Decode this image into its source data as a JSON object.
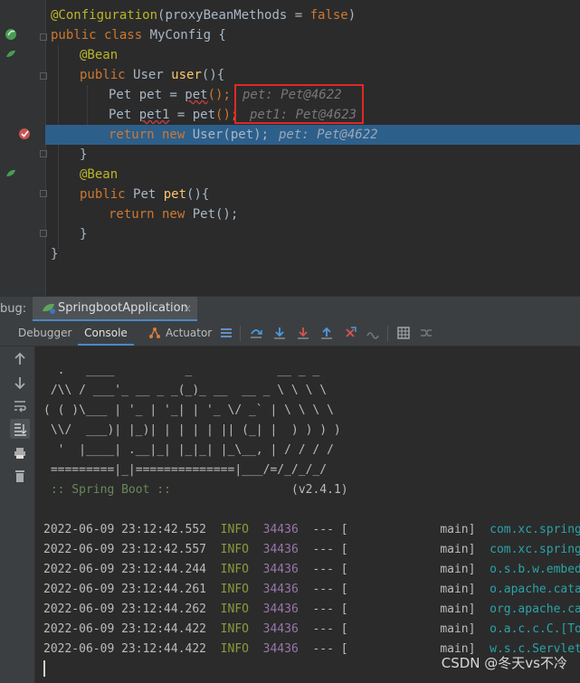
{
  "editor": {
    "lines": {
      "l1_annotation": "@Configuration",
      "l1_args": "(proxyBeanMethods = ",
      "l1_false": "false",
      "l1_close": ")",
      "l2_public": "public class ",
      "l2_name": "MyConfig {",
      "l3": "@Bean",
      "l4_public": "public ",
      "l4_type": "User ",
      "l4_method": "user",
      "l4_rest": "(){",
      "l5_code": "Pet pet = ",
      "l5_call": "pet",
      "l5_end": "();",
      "l5_hint": "pet: Pet@4622",
      "l6_code": "Pet ",
      "l6_var": "pet1",
      "l6_eq": " = ",
      "l6_call": "pet",
      "l6_end": "();",
      "l6_hint": "pet1: Pet@4623",
      "l7_return": "return new ",
      "l7_code": "User(pet);",
      "l7_hint": "pet: Pet@4622",
      "l8": "}",
      "l9": "@Bean",
      "l10_public": "public ",
      "l10_type": "Pet ",
      "l10_method": "pet",
      "l10_rest": "(){",
      "l11_return": "return new ",
      "l11_code": "Pet();",
      "l12": "}",
      "l13": "}"
    }
  },
  "debug": {
    "label": "bug:",
    "config_tab": "SpringbootApplication",
    "close": "×",
    "tabs": [
      "Debugger",
      "Console",
      "Actuator"
    ]
  },
  "console": {
    "banner": [
      "  .   ____          _            __ _ _",
      " /\\\\ / ___'_ __ _ _(_)_ __  __ _ \\ \\ \\ \\",
      "( ( )\\___ | '_ | '_| | '_ \\/ _` | \\ \\ \\ \\",
      " \\\\/  ___)| |_)| | | | | || (_| |  ) ) ) )",
      "  '  |____| .__|_| |_|_| |_\\__, | / / / /",
      " =========|_|==============|___/=/_/_/_/"
    ],
    "spring_boot": " :: Spring Boot ::",
    "version": "(v2.4.1)",
    "logs": [
      {
        "ts": "2022-06-09 23:12:42.552",
        "level": "INFO",
        "pid": "34436",
        "sep": "--- [",
        "thread": "           main]",
        "logger": "com.xc.springboo"
      },
      {
        "ts": "2022-06-09 23:12:42.557",
        "level": "INFO",
        "pid": "34436",
        "sep": "--- [",
        "thread": "           main]",
        "logger": "com.xc.springboo"
      },
      {
        "ts": "2022-06-09 23:12:44.244",
        "level": "INFO",
        "pid": "34436",
        "sep": "--- [",
        "thread": "           main]",
        "logger": "o.s.b.w.embedded"
      },
      {
        "ts": "2022-06-09 23:12:44.261",
        "level": "INFO",
        "pid": "34436",
        "sep": "--- [",
        "thread": "           main]",
        "logger": "o.apache.catalin"
      },
      {
        "ts": "2022-06-09 23:12:44.262",
        "level": "INFO",
        "pid": "34436",
        "sep": "--- [",
        "thread": "           main]",
        "logger": "org.apache.catal"
      },
      {
        "ts": "2022-06-09 23:12:44.422",
        "level": "INFO",
        "pid": "34436",
        "sep": "--- [",
        "thread": "           main]",
        "logger": "o.a.c.c.C.[Tomca"
      },
      {
        "ts": "2022-06-09 23:12:44.422",
        "level": "INFO",
        "pid": "34436",
        "sep": "--- [",
        "thread": "           main]",
        "logger": "w.s.c.ServletWeb"
      }
    ]
  },
  "watermark": "CSDN @冬天vs不冷"
}
